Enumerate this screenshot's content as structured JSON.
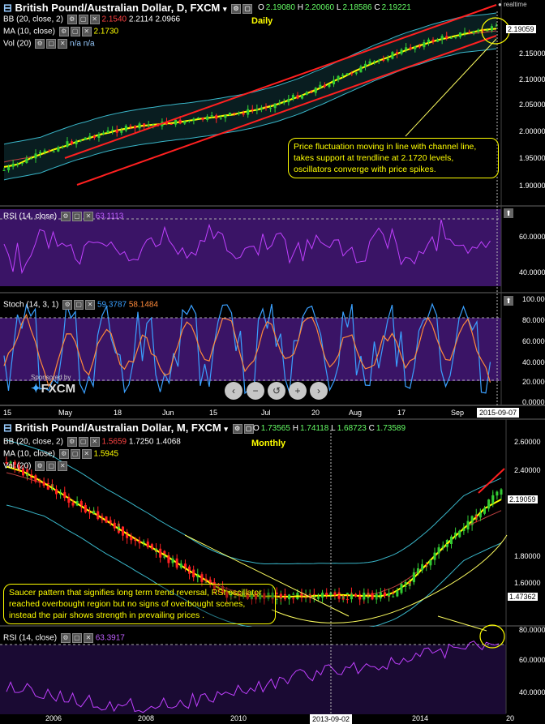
{
  "daily": {
    "title": "British Pound/Australian Dollar, D, FXCM",
    "ohlc": {
      "o_label": "O",
      "o": "2.19080",
      "h_label": "H",
      "h": "2.20060",
      "l_label": "L",
      "l": "2.18586",
      "c_label": "C",
      "c": "2.19221"
    },
    "realtime": "realtime",
    "timeframe": "Daily",
    "bb_label": "BB (20, close, 2)",
    "bb_values": [
      "2.1540",
      "2.2114",
      "2.0966"
    ],
    "ma_label": "MA (10, close)",
    "ma_value": "2.1730",
    "vol_label": "Vol (20)",
    "vol_values": [
      "n/a",
      "n/a"
    ],
    "price_ticks": [
      "2.15000",
      "2.10000",
      "2.05000",
      "2.00000",
      "1.95000",
      "1.90000"
    ],
    "last_price": "2.19059",
    "note": "Price fluctuation moving in line with channel line, takes support at trendline at 2.1720 levels, oscillators converge with price spikes.",
    "rsi_label": "RSI (14, close)",
    "rsi_value": "63.1113",
    "rsi_ticks": [
      "60.0000",
      "40.0000"
    ],
    "stoch_label": "Stoch (14, 3, 1)",
    "stoch_k": "59.3787",
    "stoch_d": "58.1484",
    "stoch_ticks": [
      "100.000",
      "80.0000",
      "60.0000",
      "40.0000",
      "20.0000",
      "0.0000"
    ],
    "sponsored": "Sponsored by",
    "brand": "FXCM",
    "x_ticks": [
      "15",
      "May",
      "18",
      "Jun",
      "15",
      "Jul",
      "20",
      "Aug",
      "17",
      "Sep"
    ],
    "date_box": "2015-09-07"
  },
  "monthly": {
    "title": "British Pound/Australian Dollar, M, FXCM",
    "ohlc": {
      "o_label": "O",
      "o": "1.73565",
      "h_label": "H",
      "h": "1.74118",
      "l_label": "L",
      "l": "1.68723",
      "c_label": "C",
      "c": "1.73589"
    },
    "timeframe": "Monthly",
    "bb_label": "BB (20, close, 2)",
    "bb_values": [
      "1.5659",
      "1.7250",
      "1.4068"
    ],
    "ma_label": "MA (10, close)",
    "ma_value": "1.5945",
    "vol_label": "Vol (20)",
    "price_ticks": [
      "2.60000",
      "2.40000",
      "1.80000",
      "1.60000"
    ],
    "last_price": "2.19059",
    "low_price": "1.47362",
    "note": "Saucer pattern that signifies long term trend reversal, RSI oscillator reached overbought region but no signs of overbought scenes, instead the pair shows strength in prevailing prices .",
    "rsi_label": "RSI (14, close)",
    "rsi_value": "63.3917",
    "rsi_ticks": [
      "80.0000",
      "60.0000",
      "40.0000"
    ],
    "x_ticks": [
      "2006",
      "2008",
      "2010",
      "2014",
      "20"
    ],
    "date_box": "2013-09-02"
  },
  "colors": {
    "bg": "#000000",
    "candle_up": "#33cc33",
    "candle_down": "#ff2222",
    "bb": "#39b6c9",
    "ma": "#ffff00",
    "channel": "#ff2020",
    "rsi": "#c040ff",
    "osc_bg": "#3a1466",
    "stoch_k": "#3aa0ff",
    "stoch_d": "#ff8a3a",
    "note": "#ffff00"
  },
  "chart_data": [
    {
      "type": "candlestick",
      "title": "British Pound/Australian Dollar, D, FXCM",
      "x": [
        "15",
        "May",
        "18",
        "Jun",
        "15",
        "Jul",
        "20",
        "Aug",
        "17",
        "Sep"
      ],
      "close_approx": [
        1.92,
        1.93,
        1.97,
        1.98,
        2.03,
        2.05,
        2.1,
        2.12,
        2.16,
        2.19
      ],
      "ylim": [
        1.88,
        2.22
      ]
    },
    {
      "type": "candlestick",
      "title": "British Pound/Australian Dollar, M, FXCM",
      "x": [
        "2006",
        "2008",
        "2010",
        "2014",
        "20"
      ],
      "close_approx": [
        2.4,
        2.05,
        1.62,
        1.5,
        2.19
      ],
      "ylim": [
        1.4,
        2.7
      ]
    }
  ]
}
